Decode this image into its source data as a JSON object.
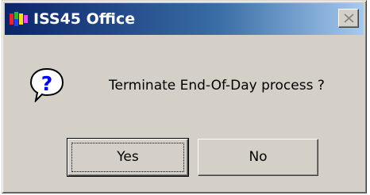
{
  "window": {
    "title": "ISS45 Office",
    "app_icon": "iss-app-icon",
    "close_icon": "close-icon"
  },
  "dialog": {
    "icon": "question-icon",
    "message": "Terminate End-Of-Day process ?",
    "buttons": {
      "yes_label": "Yes",
      "no_label": "No"
    }
  },
  "colors": {
    "title_bar_start": "#0a246a",
    "title_bar_end": "#a6caf0",
    "dialog_face": "#d4d0c8",
    "question_icon": "#0000ff"
  }
}
